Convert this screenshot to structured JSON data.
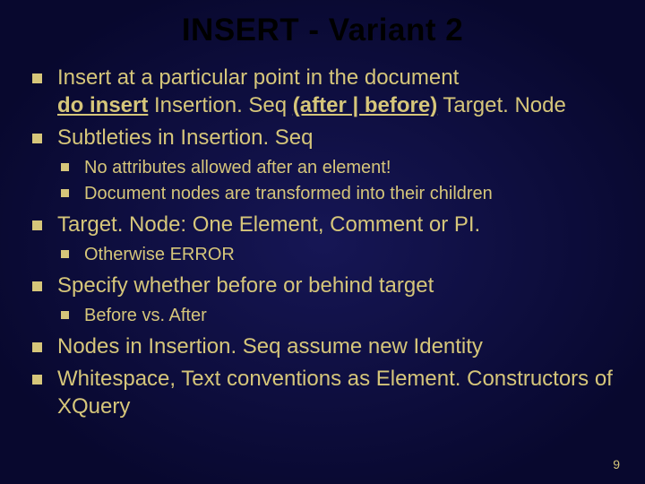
{
  "title": "INSERT - Variant 2",
  "bullets": {
    "b1": "Insert at a particular point in the document",
    "syntax": {
      "do_insert": "do insert",
      "insertion_seq": " Insertion. Seq ",
      "after_before": "(after | before)",
      "target_node": " Target. Node"
    },
    "b2": "Subtleties in Insertion. Seq",
    "b2_sub1": "No attributes allowed after an element!",
    "b2_sub2": "Document nodes are transformed into their children",
    "b3": "Target. Node: One Element, Comment or PI.",
    "b3_sub1": "Otherwise ERROR",
    "b4": "Specify whether before or behind target",
    "b4_sub1": "Before vs. After",
    "b5": "Nodes in Insertion. Seq assume new Identity",
    "b6": "Whitespace, Text conventions as Element. Constructors of XQuery"
  },
  "page_number": "9"
}
